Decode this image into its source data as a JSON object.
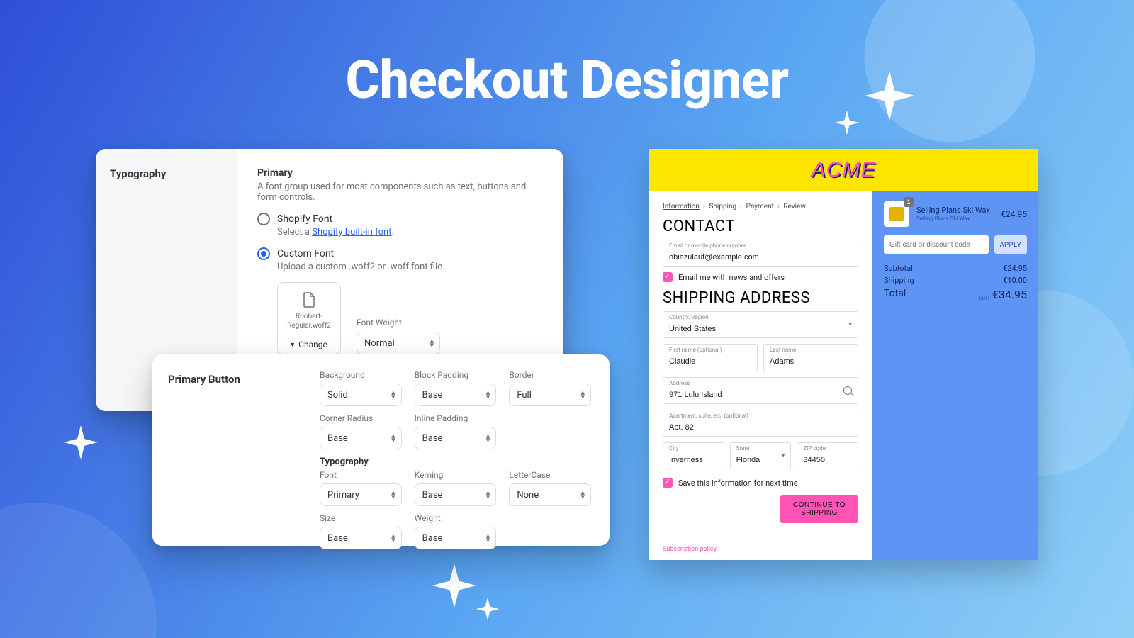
{
  "title": "Checkout Designer",
  "typo": {
    "section": "Typography",
    "primary_title": "Primary",
    "primary_sub": "A font group used for most components such as text, buttons and form controls.",
    "shopify_label": "Shopify Font",
    "shopify_hint_prefix": "Select a ",
    "shopify_hint_link": "Shopify built-in font",
    "custom_label": "Custom Font",
    "custom_hint": "Upload a custom .woff2 or .woff font file.",
    "file_name": "Roobert-Regular.woff2",
    "change_label": "Change",
    "weight_label": "Font Weight",
    "weight_value": "Normal"
  },
  "primbtn": {
    "section": "Primary Button",
    "typography_sub": "Typography",
    "fields": {
      "background": {
        "label": "Background",
        "value": "Solid"
      },
      "block_padding": {
        "label": "Block Padding",
        "value": "Base"
      },
      "border": {
        "label": "Border",
        "value": "Full"
      },
      "corner_radius": {
        "label": "Corner Radius",
        "value": "Base"
      },
      "inline_padding": {
        "label": "Inline Padding",
        "value": "Base"
      },
      "font": {
        "label": "Font",
        "value": "Primary"
      },
      "kerning": {
        "label": "Kerning",
        "value": "Base"
      },
      "lettercase": {
        "label": "LetterCase",
        "value": "None"
      },
      "size": {
        "label": "Size",
        "value": "Base"
      },
      "weight": {
        "label": "Weight",
        "value": "Base"
      }
    }
  },
  "preview": {
    "brand": "ACME",
    "crumbs": [
      "Information",
      "Shipping",
      "Payment",
      "Review"
    ],
    "contact_h": "CONTACT",
    "email_label": "Email or mobile phone number",
    "email_value": "obiezulauf@example.com",
    "news_cb": "Email me with news and offers",
    "ship_h": "SHIPPING ADDRESS",
    "country_label": "Country/Region",
    "country_value": "United States",
    "fname_label": "First name (optional)",
    "fname_value": "Claudie",
    "lname_label": "Last name",
    "lname_value": "Adams",
    "addr_label": "Address",
    "addr_value": "971 Lulu Island",
    "apt_label": "Apartment, suite, etc. (optional)",
    "apt_value": "Apt. 82",
    "city_label": "City",
    "city_value": "Inverness",
    "state_label": "State",
    "state_value": "Florida",
    "zip_label": "ZIP code",
    "zip_value": "34450",
    "save_cb": "Save this information for next time",
    "cta": "CONTINUE TO SHIPPING",
    "sub_link": "Subscription policy",
    "item_name": "Selling Plans Ski Wax",
    "item_sub": "Selling Plans Ski Wax",
    "item_qty": "1",
    "item_price": "€24.95",
    "promo_placeholder": "Gift card or discount code",
    "promo_btn": "APPLY",
    "subtotal_k": "Subtotal",
    "subtotal_v": "€24.95",
    "shipping_k": "Shipping",
    "shipping_v": "€10.00",
    "total_k": "Total",
    "total_cur": "EUR",
    "total_v": "€34.95"
  }
}
